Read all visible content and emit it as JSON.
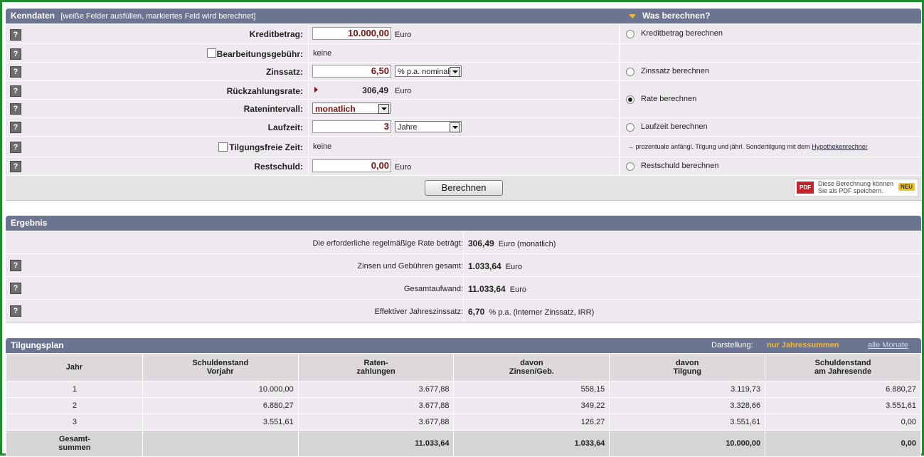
{
  "kenndaten": {
    "title": "Kenndaten",
    "subtitle": "[weiße Felder ausfüllen, markiertes Feld wird berechnet]",
    "was_title": "Was berechnen?",
    "help": "?",
    "rows": {
      "kreditbetrag": {
        "label": "Kreditbetrag:",
        "value": "10.000,00",
        "unit": "Euro",
        "radio": "Kreditbetrag berechnen"
      },
      "bearbeitung": {
        "label": "Bearbeitungsgebühr:",
        "value": "keine"
      },
      "zinssatz": {
        "label": "Zinssatz:",
        "value": "6,50",
        "select": "% p.a. nominal",
        "radio": "Zinssatz berechnen"
      },
      "rate": {
        "label": "Rückzahlungsrate:",
        "value": "306,49",
        "unit": "Euro",
        "radio": "Rate berechnen"
      },
      "intervall": {
        "label": "Ratenintervall:",
        "select": "monatlich"
      },
      "laufzeit": {
        "label": "Laufzeit:",
        "value": "3",
        "select": "Jahre",
        "radio": "Laufzeit berechnen"
      },
      "tilgungsfrei": {
        "label": "Tilgungsfreie Zeit:",
        "value": "keine",
        "note": "→ prozentuale anfängl. Tilgung und jährl. Sondertilgung mit dem",
        "note_link": "Hypothekenrechner"
      },
      "restschuld": {
        "label": "Restschuld:",
        "value": "0,00",
        "unit": "Euro",
        "radio": "Restschuld berechnen"
      }
    },
    "button": "Berechnen",
    "pdf": {
      "icon": "PDF",
      "line1": "Diese Berechnung können",
      "line2": "Sie als PDF speichern.",
      "badge": "NEU"
    }
  },
  "ergebnis": {
    "title": "Ergebnis",
    "rows": [
      {
        "label": "Die erforderliche regelmäßige Rate beträgt:",
        "value": "306,49",
        "unit": "Euro  (monatlich)"
      },
      {
        "label": "Zinsen und Gebühren gesamt:",
        "value": "1.033,64",
        "unit": "Euro"
      },
      {
        "label": "Gesamtaufwand:",
        "value": "11.033,64",
        "unit": "Euro"
      },
      {
        "label": "Effektiver Jahreszinssatz:",
        "value": "6,70",
        "unit": "% p.a.  (interner Zinssatz, IRR)"
      }
    ]
  },
  "tilgungsplan": {
    "title": "Tilgungsplan",
    "darstellung": "Darstellung:",
    "mode_active": "nur Jahressummen",
    "mode_link": "alle Monate",
    "headers": [
      [
        "Jahr"
      ],
      [
        "Schuldenstand",
        "Vorjahr"
      ],
      [
        "Raten-",
        "zahlungen"
      ],
      [
        "davon",
        "Zinsen/Geb."
      ],
      [
        "davon",
        "Tilgung"
      ],
      [
        "Schuldenstand",
        "am Jahresende"
      ]
    ],
    "rows": [
      [
        "1",
        "10.000,00",
        "3.677,88",
        "558,15",
        "3.119,73",
        "6.880,27"
      ],
      [
        "2",
        "6.880,27",
        "3.677,88",
        "349,22",
        "3.328,66",
        "3.551,61"
      ],
      [
        "3",
        "3.551,61",
        "3.677,88",
        "126,27",
        "3.551,61",
        "0,00"
      ]
    ],
    "sum_label": [
      "Gesamt-",
      "summen"
    ],
    "sums": [
      "",
      "11.033,64",
      "1.033,64",
      "10.000,00",
      "0,00"
    ]
  },
  "colors": {
    "header": "#6b7592",
    "row": "#ede9ee",
    "accent": "#f5b82e",
    "value": "#7a1010"
  }
}
